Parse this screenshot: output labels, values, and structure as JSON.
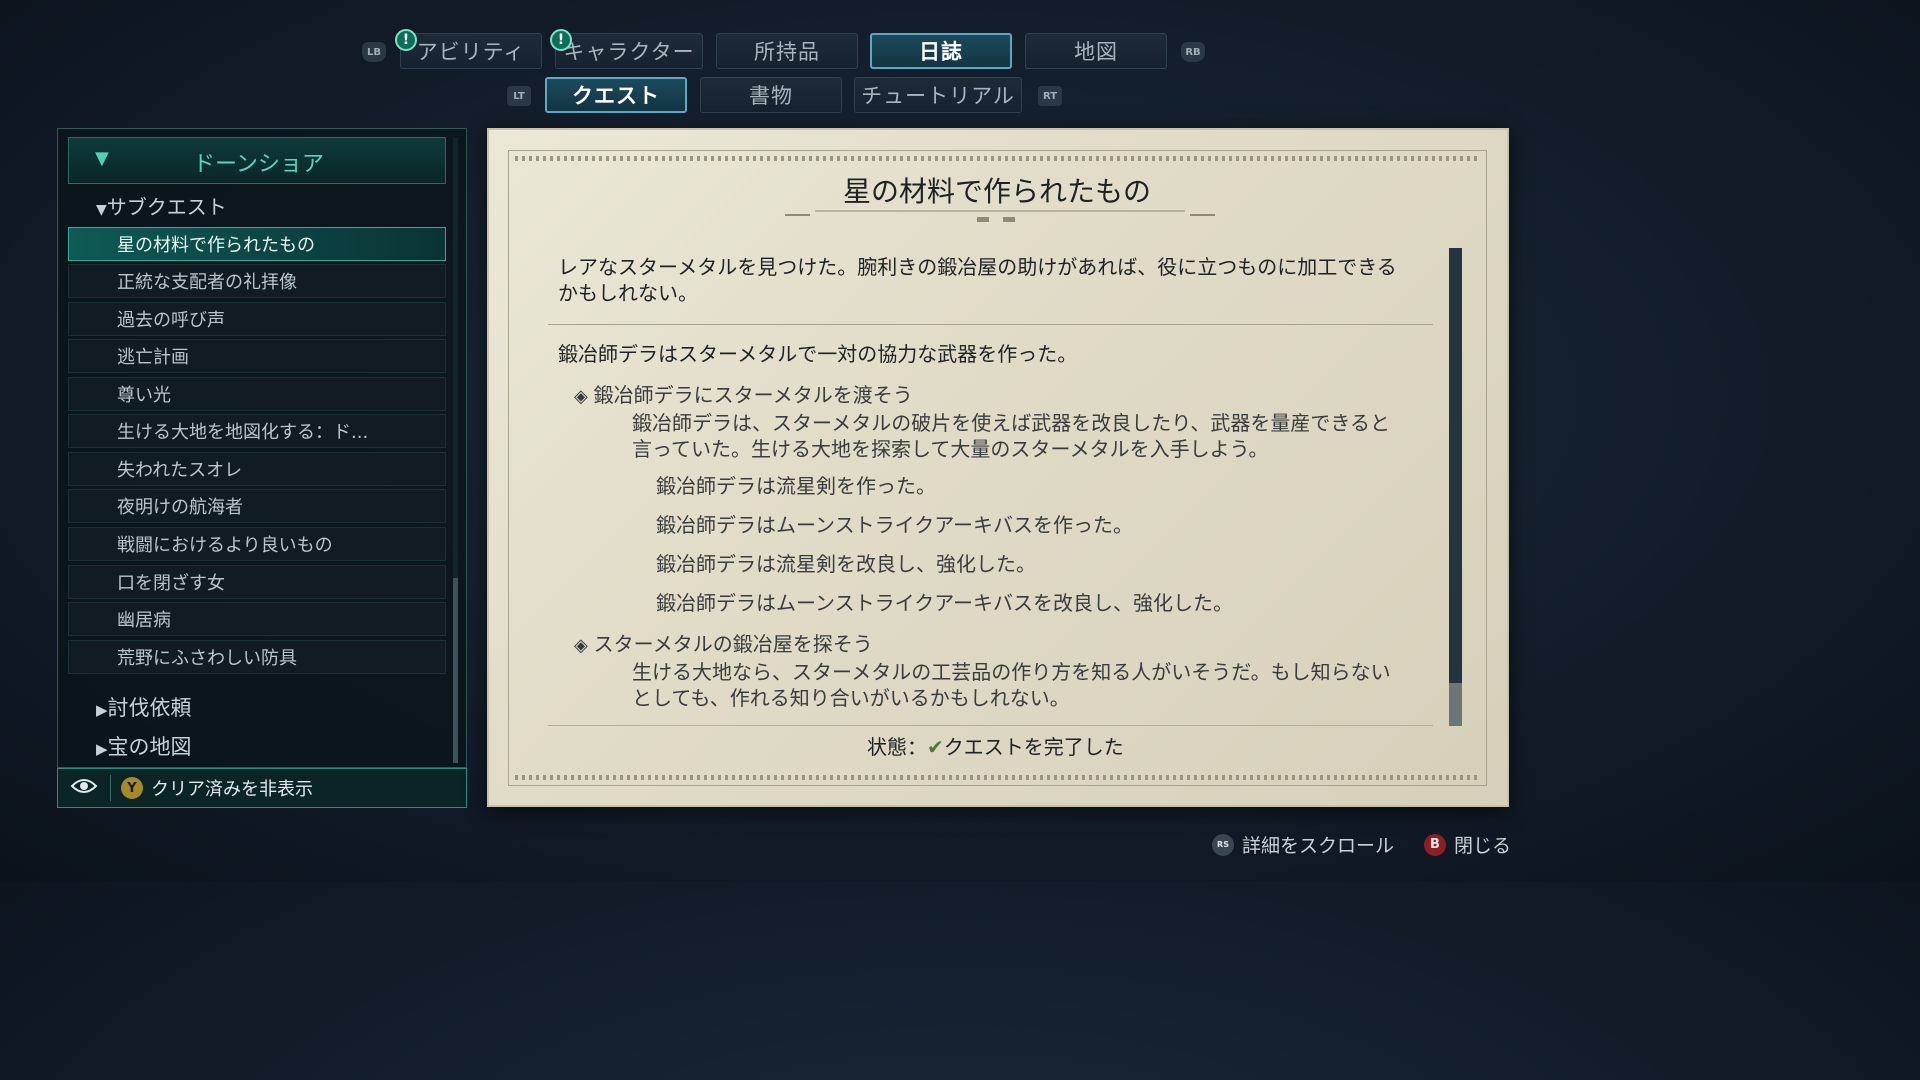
{
  "top_tabs": {
    "lb": "LB",
    "rb": "RB",
    "items": [
      {
        "label": "アビリティ",
        "alert": "!"
      },
      {
        "label": "キャラクター",
        "alert": "!"
      },
      {
        "label": "所持品"
      },
      {
        "label": "日誌",
        "active": true
      },
      {
        "label": "地図"
      }
    ]
  },
  "sub_tabs": {
    "lt": "LT",
    "rt": "RT",
    "items": [
      {
        "label": "クエスト",
        "active": true
      },
      {
        "label": "書物"
      },
      {
        "label": "チュートリアル"
      }
    ]
  },
  "quest_list": {
    "region": "ドーンショア",
    "category": "サブクエスト",
    "items": [
      "星の材料で作られたもの",
      "正統な支配者の礼拝像",
      "過去の呼び声",
      "逃亡計画",
      "尊い光",
      "生ける大地を地図化する：ド...",
      "失われたスオレ",
      "夜明けの航海者",
      "戦闘におけるより良いもの",
      "口を閉ざす女",
      "幽居病",
      "荒野にふさわしい防具"
    ],
    "collapsed_categories": [
      "討伐依頼",
      "宝の地図"
    ],
    "footer": {
      "button": "Y",
      "label": "クリア済みを非表示"
    }
  },
  "quest_detail": {
    "title": "星の材料で作られたもの",
    "intro": [
      "レアなスターメタルを見つけた。腕利きの鍛冶屋の助けがあれば、役に立つものに加工できる",
      "かもしれない。"
    ],
    "summary": "鍛冶師デラはスターメタルで一対の協力な武器を作った。",
    "objectives": [
      {
        "title": "鍛冶師デラにスターメタルを渡そう",
        "desc": [
          "鍛冶師デラは、スターメタルの破片を使えば武器を改良したり、武器を量産できると",
          "言っていた。生ける大地を探索して大量のスターメタルを入手しよう。"
        ],
        "log": [
          "鍛冶師デラは流星剣を作った。",
          "鍛冶師デラはムーンストライクアーキバスを作った。",
          "鍛冶師デラは流星剣を改良し、強化した。",
          "鍛冶師デラはムーンストライクアーキバスを改良し、強化した。"
        ]
      },
      {
        "title": "スターメタルの鍛冶屋を探そう",
        "desc": [
          "生ける大地なら、スターメタルの工芸品の作り方を知る人がいそうだ。もし知らない",
          "としても、作れる知り合いがいるかもしれない。"
        ]
      }
    ],
    "status_label": "状態：",
    "status_value": "クエストを完了した"
  },
  "hints": [
    {
      "button": "RS",
      "label": "詳細をスクロール"
    },
    {
      "button": "B",
      "label": "閉じる"
    }
  ],
  "colors": {
    "accent": "#3fa597",
    "parchment": "#e1dcc8",
    "b_button": "#8a1f24",
    "y_button": "#a48a2a"
  }
}
